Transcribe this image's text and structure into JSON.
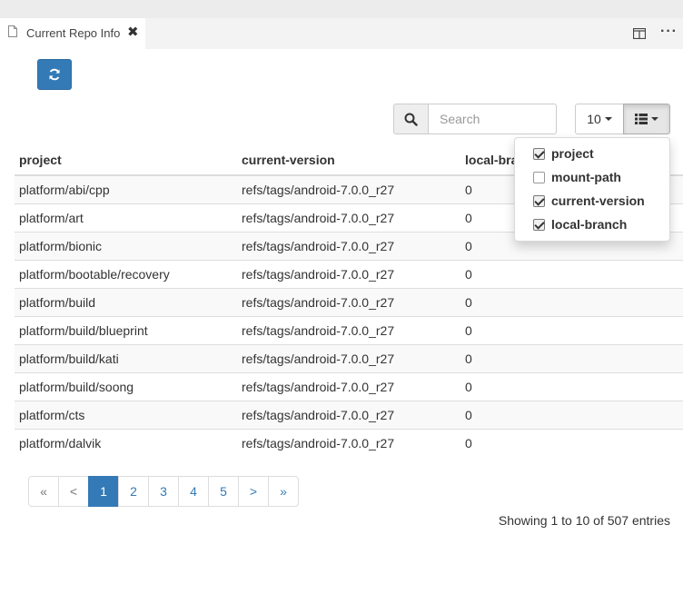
{
  "tab": {
    "title": "Current Repo Info",
    "close": "✖"
  },
  "toolbar": {
    "more": "···"
  },
  "search": {
    "placeholder": "Search",
    "value": ""
  },
  "page_size": {
    "value": "10"
  },
  "columns_menu": {
    "items": [
      {
        "label": "project",
        "checked": true
      },
      {
        "label": "mount-path",
        "checked": false
      },
      {
        "label": "current-version",
        "checked": true
      },
      {
        "label": "local-branch",
        "checked": true
      }
    ]
  },
  "table": {
    "headers": [
      "project",
      "current-version",
      "local-branch"
    ],
    "rows": [
      [
        "platform/abi/cpp",
        "refs/tags/android-7.0.0_r27",
        "0"
      ],
      [
        "platform/art",
        "refs/tags/android-7.0.0_r27",
        "0"
      ],
      [
        "platform/bionic",
        "refs/tags/android-7.0.0_r27",
        "0"
      ],
      [
        "platform/bootable/recovery",
        "refs/tags/android-7.0.0_r27",
        "0"
      ],
      [
        "platform/build",
        "refs/tags/android-7.0.0_r27",
        "0"
      ],
      [
        "platform/build/blueprint",
        "refs/tags/android-7.0.0_r27",
        "0"
      ],
      [
        "platform/build/kati",
        "refs/tags/android-7.0.0_r27",
        "0"
      ],
      [
        "platform/build/soong",
        "refs/tags/android-7.0.0_r27",
        "0"
      ],
      [
        "platform/cts",
        "refs/tags/android-7.0.0_r27",
        "0"
      ],
      [
        "platform/dalvik",
        "refs/tags/android-7.0.0_r27",
        "0"
      ]
    ]
  },
  "pagination": {
    "first": "«",
    "prev": "<",
    "pages": [
      "1",
      "2",
      "3",
      "4",
      "5"
    ],
    "active": "1",
    "next": ">",
    "last": "»"
  },
  "footer": {
    "showing": "Showing 1 to 10 of 507 entries"
  },
  "colors": {
    "primary": "#337ab7",
    "header_border": "#dddddd",
    "stripe": "#f9f9f9"
  }
}
